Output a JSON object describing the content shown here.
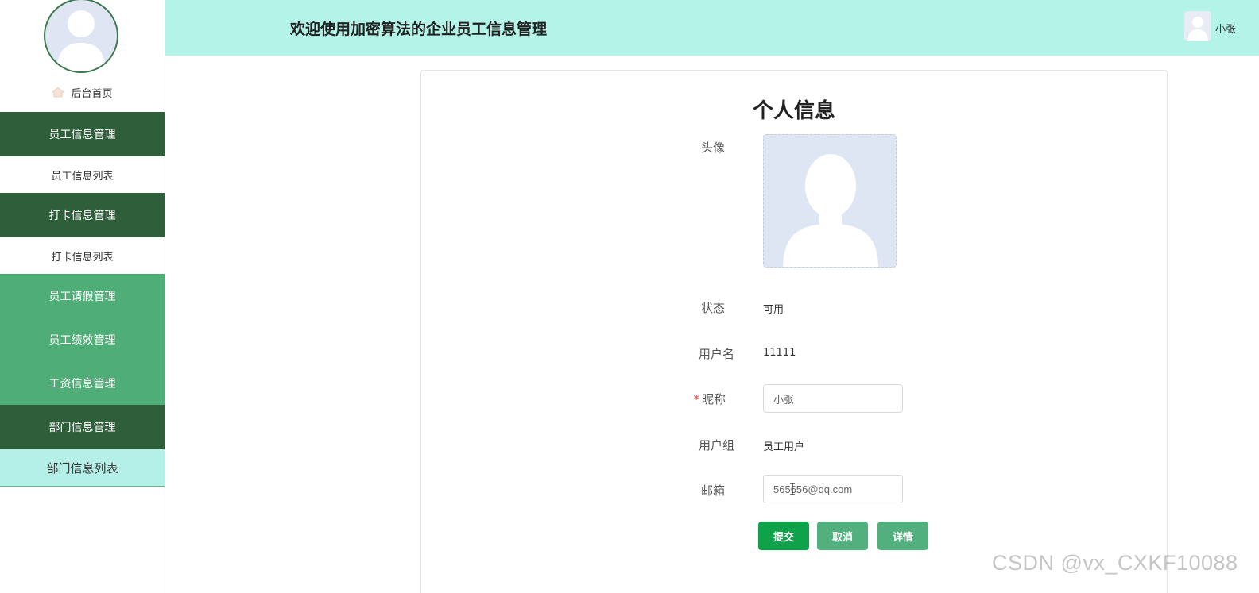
{
  "header": {
    "title": "欢迎使用加密算法的企业员工信息管理",
    "username": "小张"
  },
  "sidebar": {
    "home_label": "后台首页",
    "menu": [
      {
        "label": "员工信息管理",
        "type": "group"
      },
      {
        "label": "员工信息列表",
        "type": "sub"
      },
      {
        "label": "打卡信息管理",
        "type": "group"
      },
      {
        "label": "打卡信息列表",
        "type": "sub"
      },
      {
        "label": "员工请假管理",
        "type": "light"
      },
      {
        "label": "员工绩效管理",
        "type": "light"
      },
      {
        "label": "工资信息管理",
        "type": "light"
      },
      {
        "label": "部门信息管理",
        "type": "group"
      },
      {
        "label": "部门信息列表",
        "type": "sub-active"
      }
    ]
  },
  "profile": {
    "title": "个人信息",
    "avatar_label": "头像",
    "status_label": "状态",
    "status_value": "可用",
    "username_label": "用户名",
    "username_value": "11111",
    "nickname_label": "昵称",
    "nickname_required_mark": "*",
    "nickname_value": "小张",
    "group_label": "用户组",
    "group_value": "员工用户",
    "email_label": "邮箱",
    "email_value": "565656@qq.com",
    "submit_label": "提交",
    "cancel_label": "取消",
    "detail_label": "详情"
  },
  "watermark": "CSDN @vx_CXKF10088",
  "colors": {
    "header_bg": "#b4f3e8",
    "menu_group_bg": "#2f5f3a",
    "menu_light_bg": "#4fae78",
    "menu_active_bg": "#b4f0e7",
    "submit_bg": "#0fa24a",
    "secondary_btn_bg": "#52b07e"
  }
}
